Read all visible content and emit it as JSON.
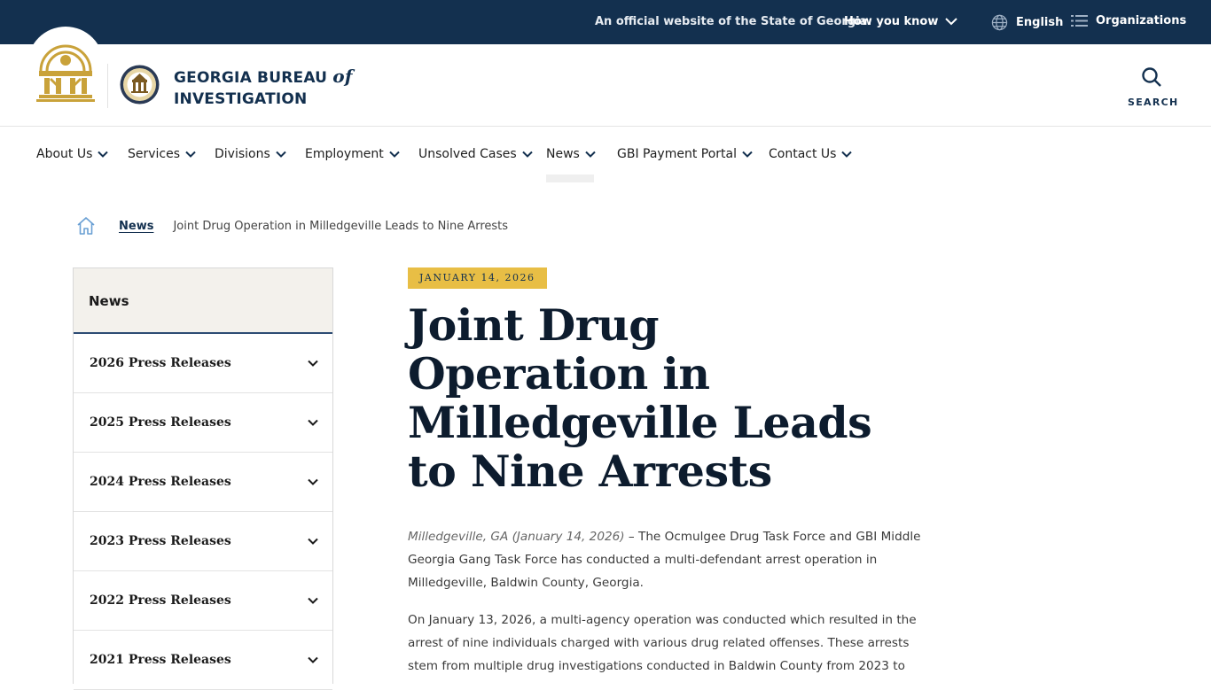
{
  "topbar": {
    "official_text": "An official website of the State of Georgia.",
    "how_you_know": "How you know",
    "language": "English",
    "organizations": "Organizations"
  },
  "header": {
    "brand_line1_main": "GEORGIA BUREAU",
    "brand_line1_of": "of",
    "brand_line2": "INVESTIGATION",
    "search_label": "SEARCH"
  },
  "nav": {
    "items": [
      {
        "label": "About Us"
      },
      {
        "label": "Services"
      },
      {
        "label": "Divisions"
      },
      {
        "label": "Employment"
      },
      {
        "label": "Unsolved Cases"
      },
      {
        "label": "News"
      },
      {
        "label": "GBI Payment Portal"
      },
      {
        "label": "Contact Us"
      }
    ],
    "active": "News"
  },
  "breadcrumb": {
    "link": "News",
    "current": "Joint Drug Operation in Milledgeville Leads to Nine Arrests"
  },
  "sidebar": {
    "heading": "News",
    "items": [
      {
        "label": "2026 Press Releases"
      },
      {
        "label": "2025 Press Releases"
      },
      {
        "label": "2024 Press Releases"
      },
      {
        "label": "2023 Press Releases"
      },
      {
        "label": "2022 Press Releases"
      },
      {
        "label": "2021 Press Releases"
      }
    ]
  },
  "article": {
    "date": "JANUARY 14, 2026",
    "title": "Joint Drug Operation in Milledgeville Leads to Nine Arrests",
    "p1_dateline": "Milledgeville, GA (January 14, 2026)",
    "p1_body": " – The Ocmulgee Drug Task Force and GBI Middle Georgia Gang Task Force has conducted a multi-defendant arrest operation in Milledgeville, Baldwin County, Georgia.",
    "p2": "On January 13, 2026, a multi-agency operation was conducted which resulted in the arrest of nine individuals charged with various drug related offenses. These arrests stem from multiple drug investigations conducted in Baldwin County from 2023 to"
  },
  "colors": {
    "navy": "#13304f",
    "gold": "#e8be45",
    "sidebar_head_bg": "#f3f1ec"
  }
}
